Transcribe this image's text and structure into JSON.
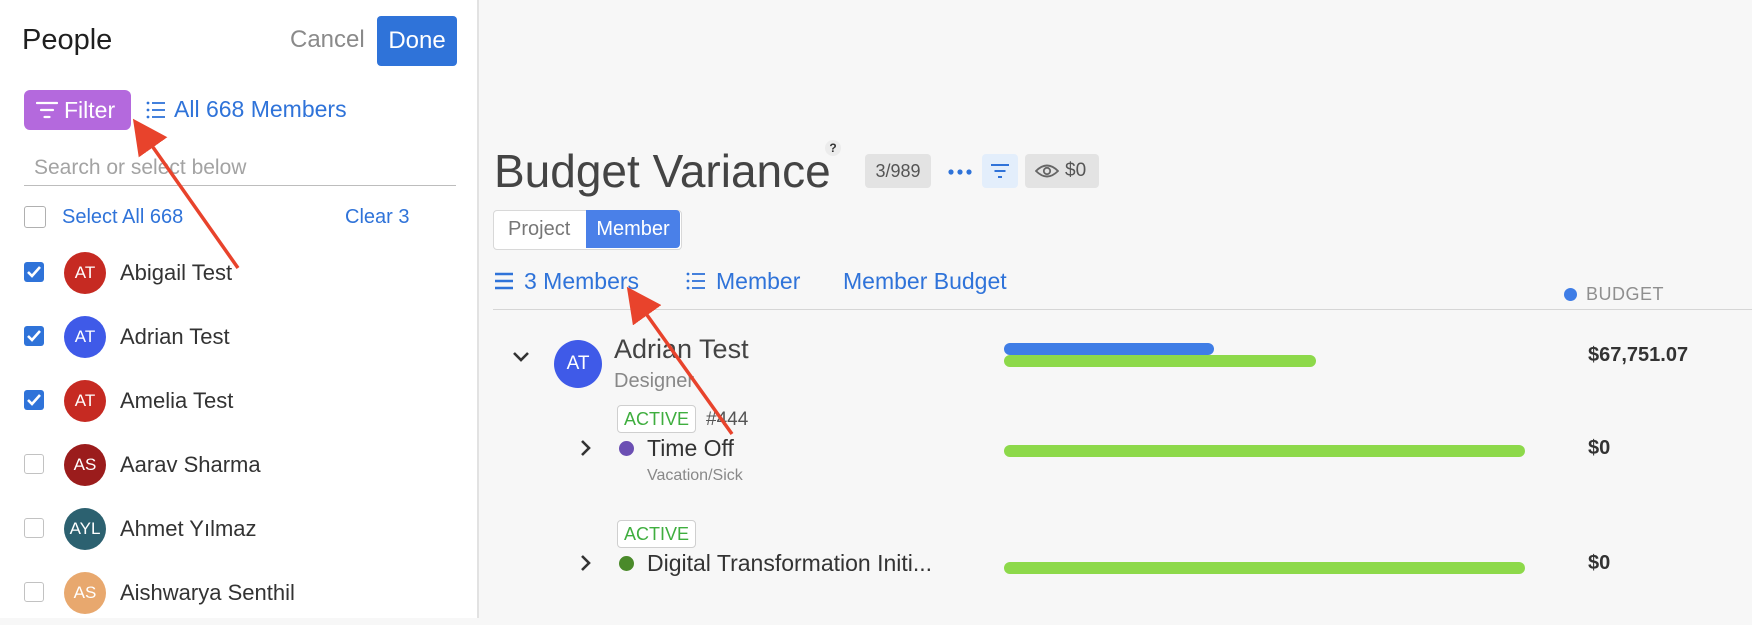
{
  "left_panel": {
    "title": "People",
    "cancel_label": "Cancel",
    "done_label": "Done",
    "filter_label": "Filter",
    "all_members_label": "All 668 Members",
    "search_placeholder": "Search or select below",
    "select_all_label": "Select All 668",
    "clear_label": "Clear 3",
    "people": [
      {
        "initials": "AT",
        "name": "Abigail Test",
        "checked": true,
        "color": "#c62a22"
      },
      {
        "initials": "AT",
        "name": "Adrian Test",
        "checked": true,
        "color": "#3f5ae8"
      },
      {
        "initials": "AT",
        "name": "Amelia Test",
        "checked": true,
        "color": "#c62a22"
      },
      {
        "initials": "AS",
        "name": "Aarav Sharma",
        "checked": false,
        "color": "#9b1c1c"
      },
      {
        "initials": "AYL",
        "name": "Ahmet Yılmaz",
        "checked": false,
        "color": "#2c6170"
      },
      {
        "initials": "AS",
        "name": "Aishwarya Senthil",
        "checked": false,
        "color": "#e8a86e"
      }
    ]
  },
  "main": {
    "heading": "Budget Variance",
    "help_mark": "?",
    "count_badge": "3/989",
    "eye_value": "$0",
    "segment": {
      "project_label": "Project",
      "member_label": "Member"
    },
    "tabs": {
      "members_count": "3 Members",
      "member": "Member",
      "member_budget": "Member Budget"
    },
    "legend_label": "BUDGET",
    "member": {
      "initials": "AT",
      "name": "Adrian Test",
      "role": "Designer",
      "amount": "$67,751.07"
    },
    "projects": [
      {
        "status": "ACTIVE",
        "number": "#444",
        "name": "Time Off",
        "subtitle": "Vacation/Sick",
        "amount": "$0",
        "dot_color": "#6b4fb3"
      },
      {
        "status": "ACTIVE",
        "number": "",
        "name": "Digital Transformation Initi...",
        "subtitle": "",
        "amount": "$0",
        "dot_color": "#4a8a2a"
      }
    ]
  },
  "colors": {
    "accent_blue": "#2f73d9",
    "filter_purple": "#b469dd",
    "budget_bar": "#3f7de6",
    "actual_bar": "#8dd94a",
    "arrow_red": "#e8432c",
    "active_green": "#3fae3f"
  },
  "icons": [
    "filter-icon",
    "list-icon",
    "checkmark-icon",
    "help-icon",
    "more-dots-icon",
    "eye-icon",
    "chevron-down-icon",
    "chevron-right-icon",
    "menu-lines-icon"
  ]
}
